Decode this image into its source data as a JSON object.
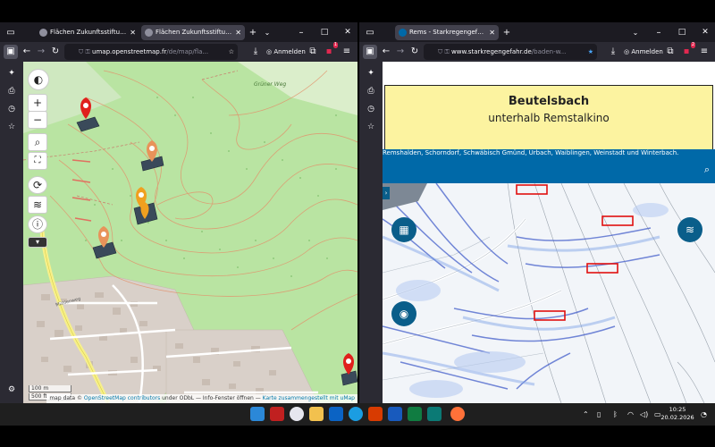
{
  "left_window": {
    "tabs": [
      {
        "label": "Flächen Zukunftsstiftung Remstal"
      },
      {
        "label": "Flächen Zukunftsstiftung Remstal"
      }
    ],
    "url_host": "umap.openstreetmap.fr",
    "url_path": "/de/map/fla...",
    "sign_in_label": "Anmelden",
    "notification_count": "1",
    "map": {
      "place_label": "Grüner Weg",
      "road_label": "Mühlenweg",
      "scale": [
        "100 m",
        "500 ft"
      ],
      "attribution_prefix": "map data © ",
      "attribution_osm": "OpenStreetMap contributors",
      "attribution_mid": " under ODbL — Info-Fenster öffnen — ",
      "attribution_link": "Karte zusammengestellt mit uMap",
      "zoom_in": "+",
      "zoom_out": "−"
    }
  },
  "right_window": {
    "tabs": [
      {
        "label": "Rems - Starkregengefahr"
      }
    ],
    "url_host": "www.starkregengefahr.de",
    "url_path": "/baden-w...",
    "sign_in_label": "Anmelden",
    "notification_count": "2",
    "page": {
      "title": "Beutelsbach",
      "subtitle": "unterhalb Remstalkino",
      "underlying_text": "Remshalden, Schorndorf, Schwäbisch Gmünd, Urbach, Waiblingen, Weinstadt und Winterbach."
    }
  },
  "taskbar": {
    "time": "10:25",
    "date": "20.02.2026"
  },
  "colors": {
    "map_green": "#b7e3a0",
    "contour_orange": "#e08a5a",
    "firefox_dark": "#2b2a33",
    "site_blue": "#0069a8",
    "highlight_yellow": "#fcf3a0",
    "marker_red": "#e0201c",
    "marker_orange": "#e8935a",
    "marker_amber": "#f0a020"
  }
}
